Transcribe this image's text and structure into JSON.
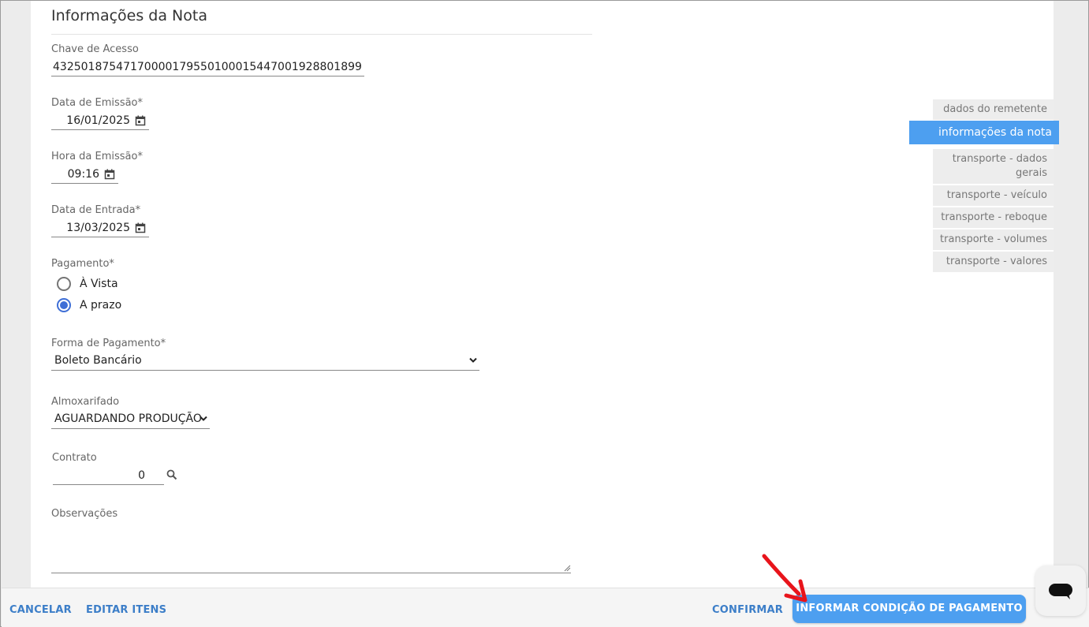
{
  "section": {
    "title": "Informações da Nota"
  },
  "fields": {
    "chave": {
      "label": "Chave de Acesso",
      "value": "43250187547170000179550100015447001928801899"
    },
    "data_emissao": {
      "label": "Data de Emissão*",
      "value": "16/01/2025"
    },
    "hora_emissao": {
      "label": "Hora da Emissão*",
      "value": "09:16"
    },
    "data_entrada": {
      "label": "Data de Entrada*",
      "value": "13/03/2025"
    },
    "pagamento": {
      "label": "Pagamento*",
      "options": [
        "À Vista",
        "A prazo"
      ],
      "selected": "A prazo"
    },
    "forma_pagamento": {
      "label": "Forma de Pagamento*",
      "value": "Boleto Bancário"
    },
    "almoxarifado": {
      "label": "Almoxarifado",
      "value": "AGUARDANDO PRODUÇÃO"
    },
    "contrato": {
      "label": "Contrato",
      "value": "0"
    },
    "observacoes": {
      "label": "Observações",
      "value": ""
    }
  },
  "sidenav": {
    "items": [
      {
        "label": "dados do remetente"
      },
      {
        "label": "informações da nota",
        "active": true
      },
      {
        "label": "transporte - dados gerais"
      },
      {
        "label": "transporte - veículo"
      },
      {
        "label": "transporte - reboque"
      },
      {
        "label": "transporte - volumes"
      },
      {
        "label": "transporte - valores"
      }
    ]
  },
  "footer": {
    "cancel_label": "CANCELAR",
    "edit_items_label": "EDITAR ITENS",
    "confirm_label": "CONFIRMAR",
    "primary_label": "INFORMAR CONDIÇÃO DE PAGAMENTO"
  },
  "icons": {
    "calendar": "calendar-icon",
    "search": "search-icon",
    "chevron": "chevron-down-icon",
    "chat": "chat-icon",
    "annotation": "red-arrow-icon"
  },
  "colors": {
    "accent": "#4d9ff0",
    "link": "#3c7ec8",
    "radio_selected": "#3f6fd6",
    "annotation_arrow": "#e8141b"
  }
}
